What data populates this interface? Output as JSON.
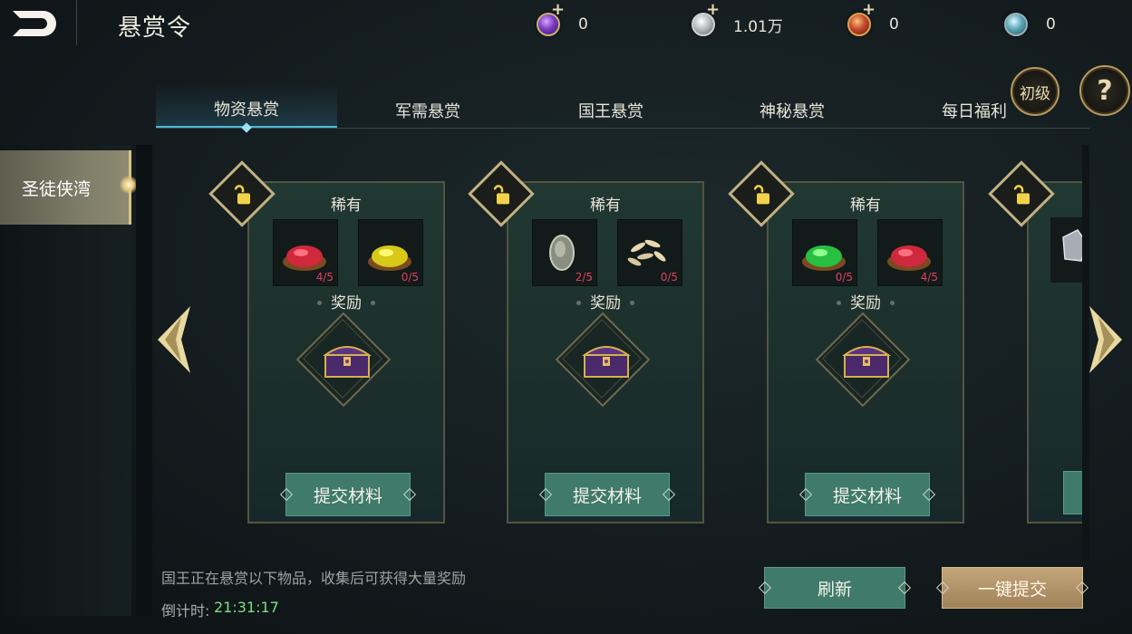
{
  "header": {
    "title": "悬赏令",
    "currencies": [
      {
        "icon": "purple-gem-icon",
        "value": "0",
        "color": "#7a3cc0"
      },
      {
        "icon": "silver-coin-icon",
        "value": "1.01万",
        "color": "#b8bcc0"
      },
      {
        "icon": "red-token-icon",
        "value": "0",
        "color": "#c24a2a"
      },
      {
        "icon": "blue-crystal-icon",
        "value": "0",
        "color": "#5aa8b8"
      }
    ],
    "level_badge": "初级",
    "help_label": "?"
  },
  "tabs": [
    {
      "label": "物资悬赏",
      "active": true
    },
    {
      "label": "军需悬赏",
      "active": false
    },
    {
      "label": "国王悬赏",
      "active": false
    },
    {
      "label": "神秘悬赏",
      "active": false
    },
    {
      "label": "每日福利",
      "active": false
    }
  ],
  "sidebar": {
    "items": [
      {
        "label": "圣徒侠湾",
        "selected": true
      }
    ]
  },
  "cards": [
    {
      "rarity": "稀有",
      "reward_label": "奖励",
      "submit_label": "提交材料",
      "materials": [
        {
          "icon": "red-powder-icon",
          "count": "4/5"
        },
        {
          "icon": "yellow-powder-icon",
          "count": "0/5"
        }
      ]
    },
    {
      "rarity": "稀有",
      "reward_label": "奖励",
      "submit_label": "提交材料",
      "materials": [
        {
          "icon": "stone-icon",
          "count": "2/5"
        },
        {
          "icon": "grain-icon",
          "count": "0/5"
        }
      ]
    },
    {
      "rarity": "稀有",
      "reward_label": "奖励",
      "submit_label": "提交材料",
      "materials": [
        {
          "icon": "green-powder-icon",
          "count": "0/5"
        },
        {
          "icon": "red-powder-icon",
          "count": "4/5"
        }
      ]
    }
  ],
  "footer": {
    "hint": "国王正在悬赏以下物品，收集后可获得大量奖励",
    "countdown_label": "倒计时:",
    "countdown_value": "21:31:17",
    "refresh_label": "刷新",
    "submit_all_label": "一键提交"
  }
}
